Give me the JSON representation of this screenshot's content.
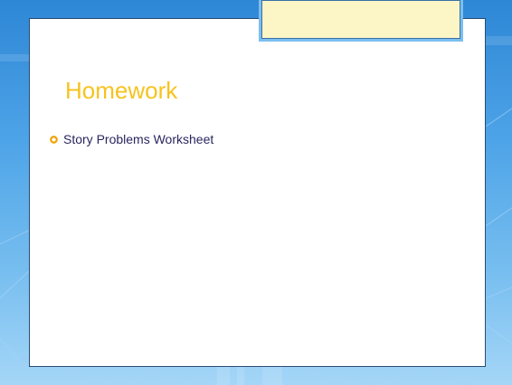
{
  "slide": {
    "title": "Homework",
    "bullets": [
      {
        "text": "Story Problems Worksheet"
      }
    ]
  },
  "colors": {
    "title": "#f7c31f",
    "bullet_text": "#2a2660",
    "bullet_marker": "#f0a000",
    "background": "#4fa5e8",
    "title_tab": "#fcf5c6"
  }
}
